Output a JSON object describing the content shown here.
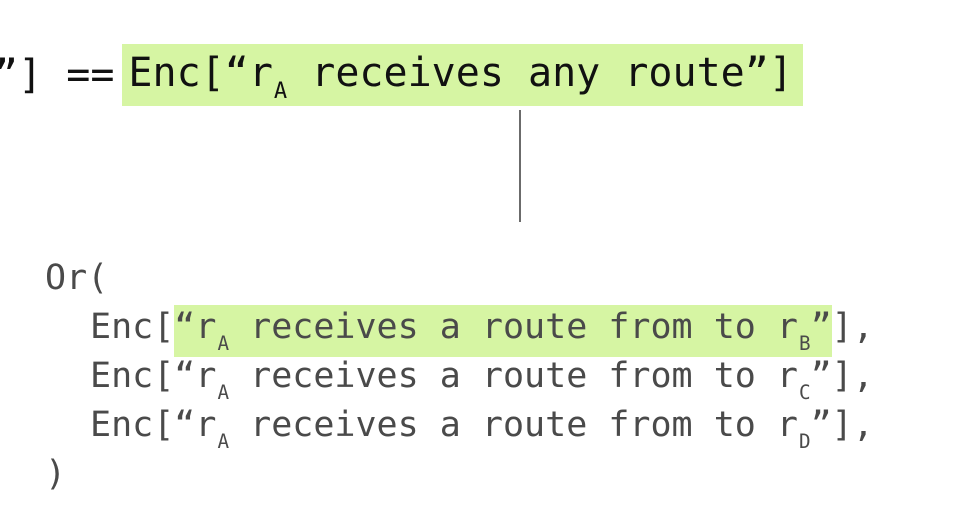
{
  "top": {
    "lhs_tail": "”] ==",
    "enc_prefix": "Enc[“r",
    "enc_sub": "A",
    "enc_rest": " receives any route”]"
  },
  "code": {
    "open": "Or(",
    "close": ")",
    "lines": [
      {
        "prefix": "Enc[",
        "quote_open": "“r",
        "sub_a": "A",
        "middle": " receives a route from to r",
        "sub_b": "B",
        "quote_close": "”",
        "suffix": "],"
      },
      {
        "prefix": "Enc[",
        "quote_open": "“r",
        "sub_a": "A",
        "middle": " receives a route from to r",
        "sub_b": "C",
        "quote_close": "”",
        "suffix": "],"
      },
      {
        "prefix": "Enc[",
        "quote_open": "“r",
        "sub_a": "A",
        "middle": " receives a route from to r",
        "sub_b": "D",
        "quote_close": "”",
        "suffix": "],"
      }
    ]
  },
  "colors": {
    "highlight": "#d6f5a3",
    "connector": "#6b6b6b",
    "text_top": "#111111",
    "text_code": "#4a4a4a"
  }
}
